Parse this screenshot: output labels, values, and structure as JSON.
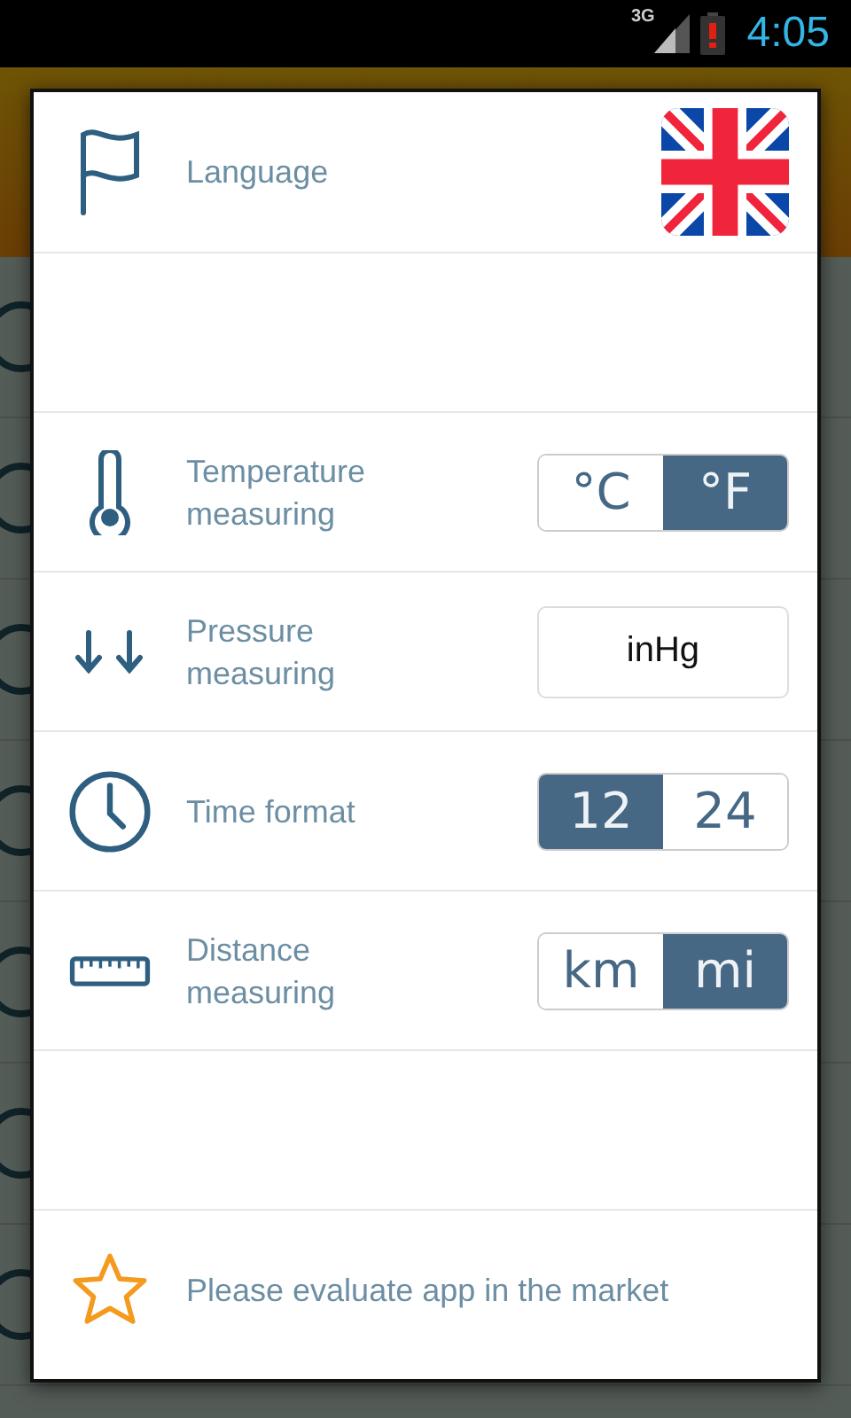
{
  "status_bar": {
    "network": "3G",
    "time": "4:05"
  },
  "settings": [
    {
      "kind": "language",
      "label": "Language"
    },
    {
      "kind": "spacer"
    },
    {
      "kind": "toggle",
      "label": "Temperature measuring",
      "options": [
        {
          "label": "°C",
          "selected": false
        },
        {
          "label": "°F",
          "selected": true
        }
      ]
    },
    {
      "kind": "button",
      "label": "Pressure measuring",
      "value": "inHg"
    },
    {
      "kind": "toggle",
      "label": "Time format",
      "options": [
        {
          "label": "12",
          "selected": true
        },
        {
          "label": "24",
          "selected": false
        }
      ]
    },
    {
      "kind": "toggle",
      "label": "Distance measuring",
      "options": [
        {
          "label": "km",
          "selected": false
        },
        {
          "label": "mi",
          "selected": true
        }
      ]
    },
    {
      "kind": "spacer"
    },
    {
      "kind": "link",
      "label": "Please evaluate app in the market"
    }
  ]
}
